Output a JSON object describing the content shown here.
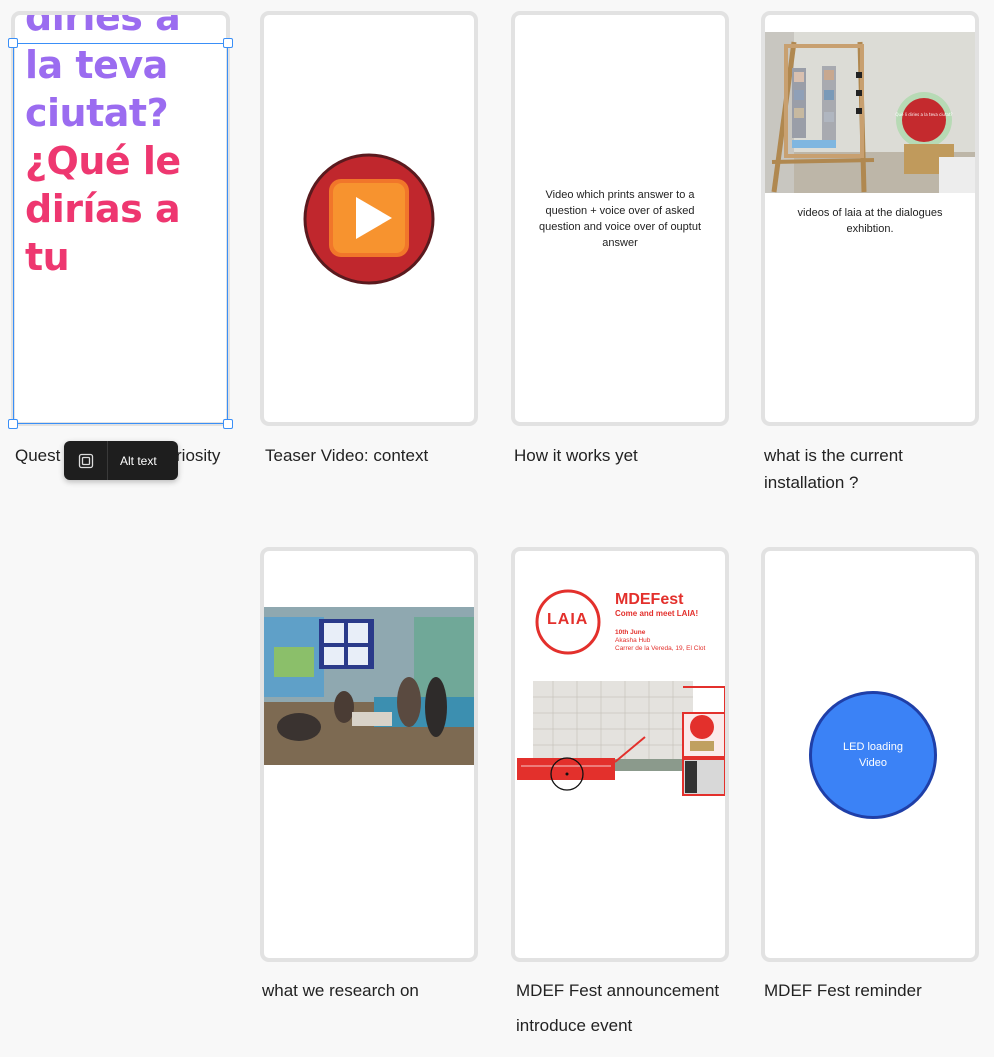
{
  "cards": [
    {
      "caption_visible_start": "Quest",
      "caption_visible_end": "riosity",
      "poster_lines": [
        {
          "text": "diries a",
          "color": "#9b6cf0"
        },
        {
          "text": "la teva",
          "color": "#9b6cf0"
        },
        {
          "text": "ciutat?",
          "color": "#9b6cf0"
        },
        {
          "text": "¿Qué le",
          "color": "#ee3770"
        },
        {
          "text": "dirías a",
          "color": "#ee3770"
        },
        {
          "text": "tu",
          "color": "#ee3770"
        }
      ]
    },
    {
      "caption": "Teaser Video: context",
      "icon": "play-button-icon"
    },
    {
      "caption": "How it works yet",
      "body": "Video which prints answer to a question + voice over of asked question and voice over of ouptut answer"
    },
    {
      "caption_line1": "what is the current",
      "caption_line2": "installation ?",
      "body": "videos of laia at the dialogues exhibtion.",
      "sign_text": "Què li diries a la teva ciutat?"
    },
    {
      "caption": "what we research on"
    },
    {
      "caption_line1": "MDEF Fest announcement",
      "caption_line2": "introduce event",
      "logo": "LAIA",
      "title": "MDEFest",
      "subtitle": "Come and meet LAIA!",
      "date": "10th June",
      "venue": "Akasha Hub",
      "address": "Carrer de la Vereda, 19, El Clot"
    },
    {
      "caption": "MDEF Fest reminder",
      "circle_text": "LED loading Video"
    }
  ],
  "toolbar": {
    "alt_text_label": "Alt text",
    "icon": "frame-icon"
  },
  "colors": {
    "selection": "#3a8ff7",
    "accent_red": "#e3302c",
    "led_blue": "#3b82f6"
  }
}
